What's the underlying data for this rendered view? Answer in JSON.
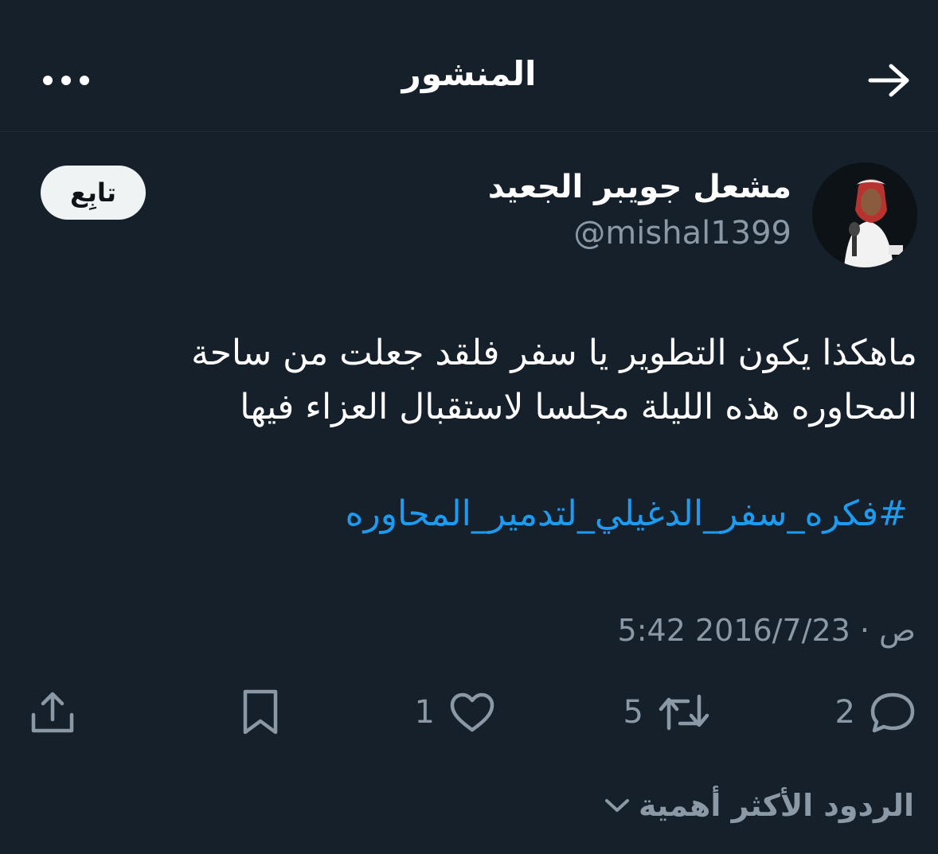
{
  "header": {
    "title": "المنشور"
  },
  "author": {
    "name": "مشعل جويبر الجعيد",
    "handle": "@mishal1399",
    "follow_label": "تابِع"
  },
  "post": {
    "text": "ماهكذا يكون التطوير يا سفر فلقد جعلت من ساحة المحاوره هذه الليلة مجلسا لاستقبال العزاء فيها",
    "hashtag": "#فكره_سفر_الدغيلي_لتدمير_المحاوره",
    "timestamp": "5:42 ص · 2016/7/23"
  },
  "actions": {
    "reply_count": "2",
    "repost_count": "5",
    "like_count": "1"
  },
  "replies": {
    "sort_label": "الردود الأكثر أهمية"
  },
  "colors": {
    "background": "#15202b",
    "muted": "#8b98a5",
    "link": "#1d9bf0"
  }
}
